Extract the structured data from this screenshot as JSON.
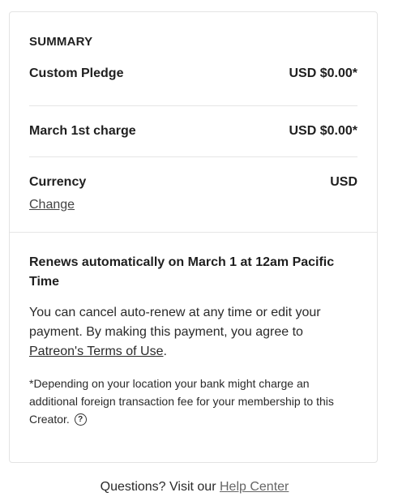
{
  "summary": {
    "title": "SUMMARY",
    "custom_pledge": {
      "label": "Custom Pledge",
      "value": "USD $0.00*"
    },
    "march_charge": {
      "label": "March 1st charge",
      "value": "USD $0.00*"
    },
    "currency": {
      "label": "Currency",
      "value": "USD",
      "change_link": "Change"
    }
  },
  "renewal": {
    "title": "Renews automatically on March 1 at 12am Pacific Time",
    "text_before_link": "You can cancel auto-renew at any time or edit your payment. By making this payment, you agree to ",
    "terms_link": "Patreon's Terms of Use",
    "text_after_link": ".",
    "footnote": "*Depending on your location your bank might charge an additional foreign transaction fee for your membership to this Creator.",
    "help_icon": "question-circle-icon"
  },
  "footer": {
    "text": "Questions? Visit our ",
    "help_link": "Help Center"
  }
}
